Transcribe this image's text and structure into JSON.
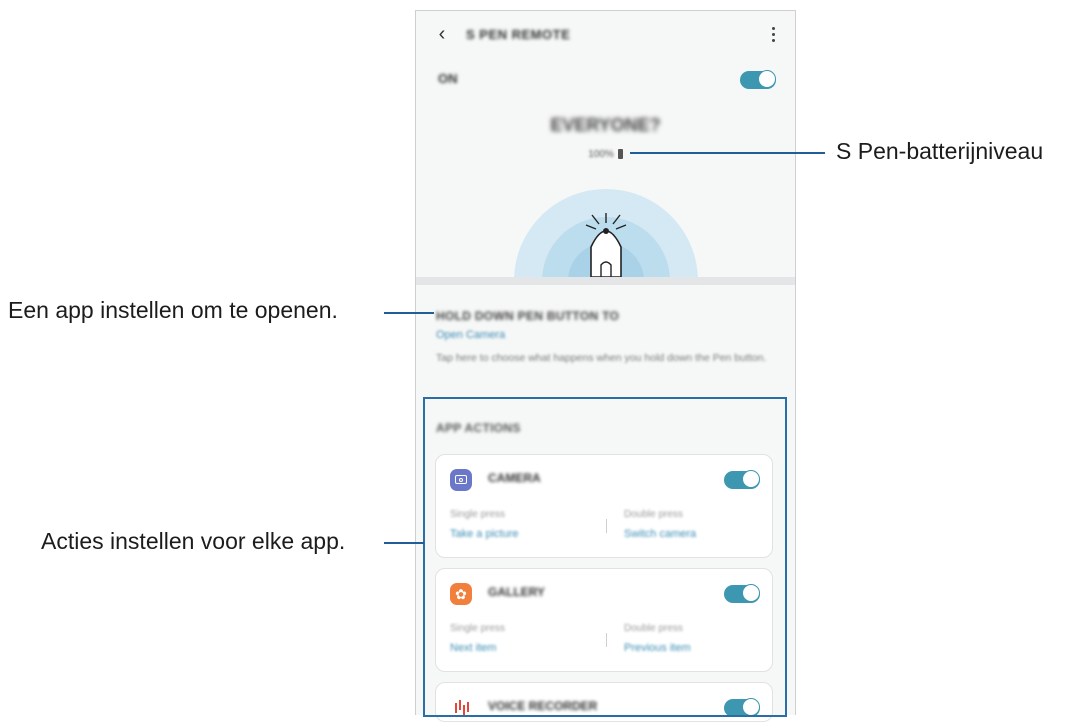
{
  "screen": {
    "title": "S PEN REMOTE",
    "on_label": "ON",
    "device_name": "EVERYONE?",
    "battery_percent": "100%",
    "hold_section": {
      "title": "HOLD DOWN PEN BUTTON TO",
      "selected_app": "Open Camera",
      "description": "Tap here to choose what happens when you hold down the Pen button."
    },
    "app_actions": {
      "title": "APP ACTIONS",
      "items": [
        {
          "name": "CAMERA",
          "icon": "camera-icon",
          "enabled": true,
          "single_press_caption": "Single press",
          "single_press_value": "Take a picture",
          "double_press_caption": "Double press",
          "double_press_value": "Switch camera"
        },
        {
          "name": "GALLERY",
          "icon": "gallery-icon",
          "enabled": true,
          "single_press_caption": "Single press",
          "single_press_value": "Next item",
          "double_press_caption": "Double press",
          "double_press_value": "Previous item"
        },
        {
          "name": "VOICE RECORDER",
          "icon": "voice-recorder-icon",
          "enabled": true
        }
      ]
    }
  },
  "callouts": {
    "battery": "S Pen-batterijniveau",
    "open_app": "Een app instellen om te openen.",
    "app_actions": "Acties instellen voor elke app."
  },
  "colors": {
    "accent": "#3e97b0",
    "link": "#3e8fb5",
    "callout_line": "#1f5e99",
    "highlight_box": "#2b6da6",
    "camera_icon": "#6b78c9",
    "gallery_icon": "#f2803d",
    "voice_icon": "#e6463a"
  }
}
